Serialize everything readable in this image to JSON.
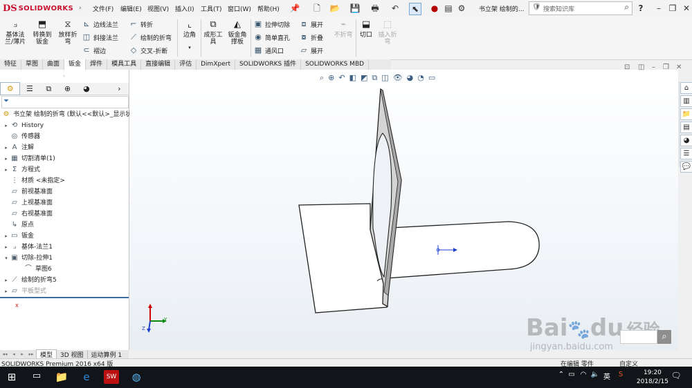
{
  "app": {
    "logo_text": "SOLIDWORKS",
    "document_title": "书立架 绘制的...",
    "search_placeholder": "搜索知识库",
    "help_icon": "?",
    "status_text": "SOLIDWORKS Premium 2016 x64 版",
    "status_right_a": "在编辑 零件",
    "status_right_b": "自定义"
  },
  "menu": [
    {
      "label": "文件(F)"
    },
    {
      "label": "编辑(E)"
    },
    {
      "label": "视图(V)"
    },
    {
      "label": "插入(I)"
    },
    {
      "label": "工具(T)"
    },
    {
      "label": "窗口(W)"
    },
    {
      "label": "帮助(H)"
    }
  ],
  "ribbon": {
    "base_flange": "基体法\n兰/薄片",
    "convert_sheet": "转换到\n钣金",
    "lofted_bend": "放样折\n弯",
    "edge_flange": "边线法兰",
    "miter_flange": "斜接法兰",
    "hem": "褶边",
    "jog": "转折",
    "sketched_bend": "绘制的折弯",
    "cross_break": "交叉-折断",
    "corner": "边角",
    "forming_tool": "成形工\n具",
    "gusset": "钣金角\n撑板",
    "extruded_cut": "拉伸切除",
    "simple_hole": "简单直孔",
    "vent": "通风口",
    "unfold": "展开",
    "fold": "折叠",
    "flatten": "展开",
    "no_bends": "不折弯",
    "rip": "切口",
    "insert_bends": "插入折\n弯"
  },
  "command_tabs": [
    {
      "label": "特征",
      "active": false
    },
    {
      "label": "草图",
      "active": false
    },
    {
      "label": "曲面",
      "active": false
    },
    {
      "label": "钣金",
      "active": true
    },
    {
      "label": "焊件",
      "active": false
    },
    {
      "label": "模具工具",
      "active": false
    },
    {
      "label": "直接编辑",
      "active": false
    },
    {
      "label": "评估",
      "active": false
    },
    {
      "label": "DimXpert",
      "active": false
    },
    {
      "label": "SOLIDWORKS 插件",
      "active": false
    },
    {
      "label": "SOLIDWORKS MBD",
      "active": false
    }
  ],
  "tree": {
    "root": "书立架 绘制的折弯  (默认<<默认>_显示状",
    "items": [
      {
        "label": "History",
        "icon": "history-icon",
        "expandable": true
      },
      {
        "label": "传感器",
        "icon": "sensor-icon",
        "expandable": false
      },
      {
        "label": "注解",
        "icon": "annotation-icon",
        "expandable": true
      },
      {
        "label": "切割清单(1)",
        "icon": "cutlist-icon",
        "expandable": true
      },
      {
        "label": "方程式",
        "icon": "equation-icon",
        "expandable": true
      },
      {
        "label": "材质 <未指定>",
        "icon": "material-icon",
        "expandable": false
      },
      {
        "label": "前视基准面",
        "icon": "plane-icon",
        "expandable": false
      },
      {
        "label": "上视基准面",
        "icon": "plane-icon",
        "expandable": false
      },
      {
        "label": "右视基准面",
        "icon": "plane-icon",
        "expandable": false
      },
      {
        "label": "原点",
        "icon": "origin-icon",
        "expandable": false
      },
      {
        "label": "钣金",
        "icon": "sheetmetal-icon",
        "expandable": true
      },
      {
        "label": "基体-法兰1",
        "icon": "flange-icon",
        "expandable": true
      },
      {
        "label": "切除-拉伸1",
        "icon": "cut-icon",
        "expandable": true,
        "expanded": true
      },
      {
        "label": "草图6",
        "icon": "sketch-icon",
        "expandable": false,
        "child": true
      },
      {
        "label": "绘制的折弯5",
        "icon": "bend-icon",
        "expandable": true
      },
      {
        "label": "平板型式",
        "icon": "flatpattern-icon",
        "expandable": true,
        "disabled": true
      }
    ]
  },
  "bottom_tabs": [
    {
      "label": "模型",
      "active": true
    },
    {
      "label": "3D 视图",
      "active": false
    },
    {
      "label": "运动算例 1",
      "active": false
    }
  ],
  "taskbar": {
    "time": "19:20",
    "date": "2018/2/15",
    "ime": "英"
  },
  "watermark": {
    "brand": "Bai",
    "brand2": "du",
    "cn": "经验",
    "url": "jingyan.baidu.com"
  },
  "colors": {
    "accent_red": "#c8102e",
    "tree_selection_blue": "#3b6ea5",
    "axis_x": "#d10000",
    "axis_y": "#0a8a0a",
    "axis_z": "#1f3fd1"
  }
}
